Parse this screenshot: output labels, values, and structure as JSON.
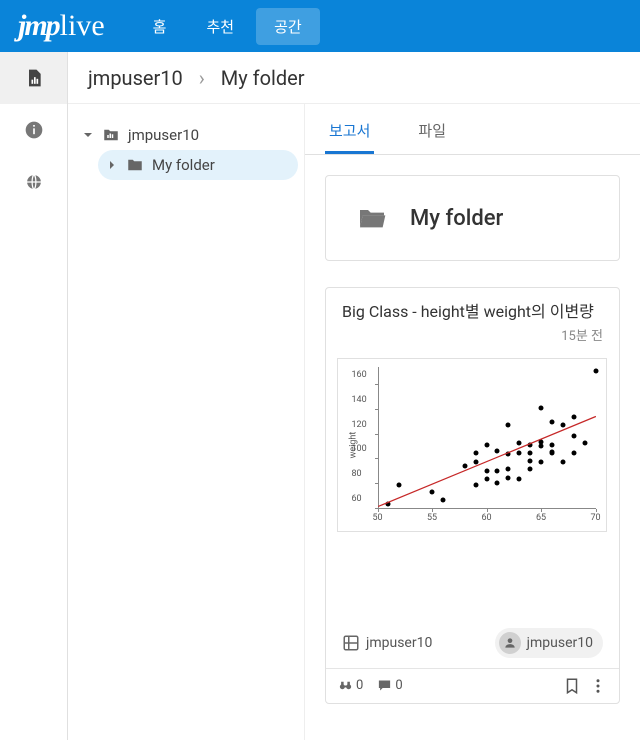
{
  "brand": "jmplive",
  "nav": {
    "items": [
      "홈",
      "추천",
      "공간"
    ],
    "active_index": 2
  },
  "breadcrumb": {
    "items": [
      "jmpuser10",
      "My folder"
    ]
  },
  "tree": {
    "root": "jmpuser10",
    "children": [
      {
        "label": "My folder",
        "selected": true
      }
    ]
  },
  "tabs": {
    "items": [
      "보고서",
      "파일"
    ],
    "active_index": 0
  },
  "folder_header": {
    "title": "My folder"
  },
  "card": {
    "title": "Big Class - height별 weight의 이변량",
    "time": "15분 전",
    "workspace": "jmpuser10",
    "author": "jmpuser10",
    "view_count": 0,
    "comment_count": 0
  },
  "chart_data": {
    "type": "scatter",
    "title": "",
    "xlabel": "",
    "ylabel": "weight",
    "xlim": [
      50,
      70
    ],
    "ylim": [
      60,
      175
    ],
    "xticks": [
      50,
      55,
      60,
      65,
      70
    ],
    "yticks": [
      60,
      80,
      100,
      120,
      140,
      160
    ],
    "series": [
      {
        "name": "points",
        "x": [
          51,
          52,
          55,
          56,
          58,
          59,
          59,
          59,
          60,
          60,
          60,
          61,
          61,
          61,
          62,
          62,
          62,
          62,
          63,
          63,
          63,
          64,
          64,
          64,
          64,
          65,
          65,
          65,
          65,
          66,
          66,
          66,
          66,
          67,
          67,
          68,
          68,
          68,
          69,
          70
        ],
        "y": [
          64,
          79,
          74,
          67,
          95,
          79,
          98,
          105,
          84,
          91,
          112,
          81,
          91,
          107,
          85,
          92,
          104,
          128,
          84,
          105,
          113,
          92,
          99,
          105,
          112,
          98,
          111,
          114,
          142,
          105,
          106,
          112,
          130,
          98,
          128,
          105,
          119,
          134,
          113,
          172
        ]
      }
    ],
    "fit_line": {
      "x1": 50,
      "y1": 62,
      "x2": 70,
      "y2": 135
    }
  }
}
